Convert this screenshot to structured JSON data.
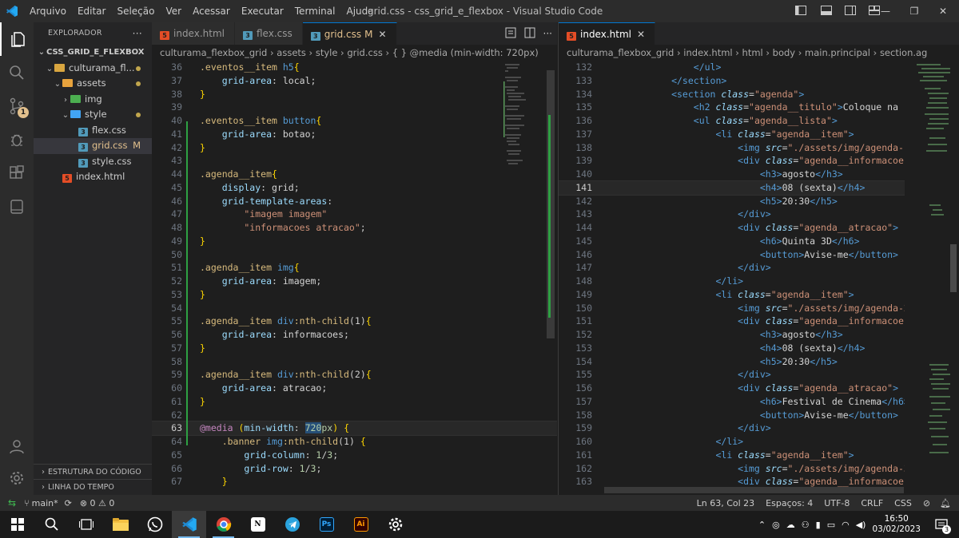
{
  "titlebar": {
    "menu": [
      "Arquivo",
      "Editar",
      "Seleção",
      "Ver",
      "Acessar",
      "Executar",
      "Terminal",
      "Ajuda"
    ],
    "title": "grid.css - css_grid_e_flexbox - Visual Studio Code"
  },
  "activity": {
    "source_control_badge": "1"
  },
  "sidebar": {
    "header": "EXPLORADOR",
    "root": "CSS_GRID_E_FLEXBOX",
    "tree": [
      {
        "label": "culturama_fl...",
        "type": "folder",
        "indent": 1,
        "open": true,
        "dot": true
      },
      {
        "label": "assets",
        "type": "folder",
        "indent": 2,
        "open": true,
        "dot": true
      },
      {
        "label": "img",
        "type": "folder",
        "indent": 3,
        "open": false,
        "dot": false
      },
      {
        "label": "style",
        "type": "folder",
        "indent": 3,
        "open": true,
        "dot": true
      },
      {
        "label": "flex.css",
        "type": "css",
        "indent": 4
      },
      {
        "label": "grid.css",
        "type": "css",
        "indent": 4,
        "selected": true,
        "badge": "M"
      },
      {
        "label": "style.css",
        "type": "css",
        "indent": 4
      },
      {
        "label": "index.html",
        "type": "html",
        "indent": 2
      }
    ],
    "footer": [
      "ESTRUTURA DO CÓDIGO",
      "LINHA DO TEMPO"
    ]
  },
  "left_editor": {
    "tabs": [
      {
        "label": "index.html",
        "type": "html"
      },
      {
        "label": "flex.css",
        "type": "css"
      },
      {
        "label": "grid.css",
        "type": "css",
        "active": true,
        "modified": "M"
      }
    ],
    "breadcrumb": [
      "culturama_flexbox_grid",
      "assets",
      "style",
      "grid.css",
      "{ } @media (min-width: 720px)"
    ],
    "lines": [
      {
        "n": 36,
        "t": [
          [
            "sel-s",
            ".eventos__item "
          ],
          [
            "tag",
            "h5"
          ],
          [
            "br1",
            "{"
          ]
        ]
      },
      {
        "n": 37,
        "t": [
          [
            "prop",
            "    grid-area"
          ],
          [
            "punc",
            ": "
          ],
          [
            "txt",
            "local"
          ],
          [
            "punc",
            ";"
          ]
        ]
      },
      {
        "n": 38,
        "t": [
          [
            "br1",
            "}"
          ]
        ]
      },
      {
        "n": 39,
        "t": []
      },
      {
        "n": 40,
        "t": [
          [
            "sel-s",
            ".eventos__item "
          ],
          [
            "tag",
            "button"
          ],
          [
            "br1",
            "{"
          ]
        ]
      },
      {
        "n": 41,
        "t": [
          [
            "prop",
            "    grid-area"
          ],
          [
            "punc",
            ": "
          ],
          [
            "txt",
            "botao"
          ],
          [
            "punc",
            ";"
          ]
        ]
      },
      {
        "n": 42,
        "t": [
          [
            "br1",
            "}"
          ]
        ]
      },
      {
        "n": 43,
        "t": []
      },
      {
        "n": 44,
        "t": [
          [
            "sel-s",
            ".agenda__item"
          ],
          [
            "br1",
            "{"
          ]
        ]
      },
      {
        "n": 45,
        "t": [
          [
            "prop",
            "    display"
          ],
          [
            "punc",
            ": "
          ],
          [
            "txt",
            "grid"
          ],
          [
            "punc",
            ";"
          ]
        ]
      },
      {
        "n": 46,
        "t": [
          [
            "prop",
            "    grid-template-areas"
          ],
          [
            "punc",
            ":"
          ]
        ]
      },
      {
        "n": 47,
        "t": [
          [
            "val",
            "        \"imagem imagem\""
          ]
        ]
      },
      {
        "n": 48,
        "t": [
          [
            "val",
            "        \"informacoes atracao\""
          ],
          [
            "punc",
            ";"
          ]
        ]
      },
      {
        "n": 49,
        "t": [
          [
            "br1",
            "}"
          ]
        ]
      },
      {
        "n": 50,
        "t": []
      },
      {
        "n": 51,
        "t": [
          [
            "sel-s",
            ".agenda__item "
          ],
          [
            "tag",
            "img"
          ],
          [
            "br1",
            "{"
          ]
        ]
      },
      {
        "n": 52,
        "t": [
          [
            "prop",
            "    grid-area"
          ],
          [
            "punc",
            ": "
          ],
          [
            "txt",
            "imagem"
          ],
          [
            "punc",
            ";"
          ]
        ]
      },
      {
        "n": 53,
        "t": [
          [
            "br1",
            "}"
          ]
        ]
      },
      {
        "n": 54,
        "t": []
      },
      {
        "n": 55,
        "t": [
          [
            "sel-s",
            ".agenda__item "
          ],
          [
            "tag",
            "div"
          ],
          [
            "sel-s",
            ":nth-child"
          ],
          [
            "punc",
            "(1)"
          ],
          [
            "br1",
            "{"
          ]
        ]
      },
      {
        "n": 56,
        "t": [
          [
            "prop",
            "    grid-area"
          ],
          [
            "punc",
            ": "
          ],
          [
            "txt",
            "informacoes"
          ],
          [
            "punc",
            ";"
          ]
        ]
      },
      {
        "n": 57,
        "t": [
          [
            "br1",
            "}"
          ]
        ]
      },
      {
        "n": 58,
        "t": []
      },
      {
        "n": 59,
        "t": [
          [
            "sel-s",
            ".agenda__item "
          ],
          [
            "tag",
            "div"
          ],
          [
            "sel-s",
            ":nth-child"
          ],
          [
            "punc",
            "(2)"
          ],
          [
            "br1",
            "{"
          ]
        ]
      },
      {
        "n": 60,
        "t": [
          [
            "prop",
            "    grid-area"
          ],
          [
            "punc",
            ": "
          ],
          [
            "txt",
            "atracao"
          ],
          [
            "punc",
            ";"
          ]
        ]
      },
      {
        "n": 61,
        "t": [
          [
            "br1",
            "}"
          ]
        ]
      },
      {
        "n": 62,
        "t": []
      },
      {
        "n": 63,
        "cur": true,
        "t": [
          [
            "kw",
            "@media"
          ],
          [
            "punc",
            " "
          ],
          [
            "br1",
            "("
          ],
          [
            "prop",
            "min-width"
          ],
          [
            "punc",
            ": "
          ],
          [
            "num",
            "720"
          ],
          [
            "num",
            "px"
          ],
          [
            "br1",
            ")"
          ],
          [
            "punc",
            " "
          ],
          [
            "br1",
            "{"
          ]
        ]
      },
      {
        "n": 64,
        "t": [
          [
            "sel-s",
            "    .banner "
          ],
          [
            "tag",
            "img"
          ],
          [
            "sel-s",
            ":nth-child"
          ],
          [
            "punc",
            "(1) "
          ],
          [
            "br1",
            "{"
          ]
        ]
      },
      {
        "n": 65,
        "t": [
          [
            "prop",
            "        grid-column"
          ],
          [
            "punc",
            ": "
          ],
          [
            "num",
            "1"
          ],
          [
            "punc",
            "/"
          ],
          [
            "num",
            "3"
          ],
          [
            "punc",
            ";"
          ]
        ]
      },
      {
        "n": 66,
        "t": [
          [
            "prop",
            "        grid-row"
          ],
          [
            "punc",
            ": "
          ],
          [
            "num",
            "1"
          ],
          [
            "punc",
            "/"
          ],
          [
            "num",
            "3"
          ],
          [
            "punc",
            ";"
          ]
        ]
      },
      {
        "n": 67,
        "t": [
          [
            "br1",
            "    }"
          ]
        ]
      }
    ]
  },
  "right_editor": {
    "tabs": [
      {
        "label": "index.html",
        "type": "html",
        "active": true
      }
    ],
    "breadcrumb": [
      "culturama_flexbox_grid",
      "index.html",
      "html",
      "body",
      "main.principal",
      "section.ag"
    ],
    "lines": [
      {
        "n": 132,
        "t": [
          [
            "tag",
            "                </ul>"
          ]
        ]
      },
      {
        "n": 133,
        "t": [
          [
            "tag",
            "            </section>"
          ]
        ]
      },
      {
        "n": 134,
        "t": [
          [
            "tag",
            "            <section "
          ],
          [
            "attr",
            "class"
          ],
          [
            "punc",
            "="
          ],
          [
            "aval",
            "\"agenda\""
          ],
          [
            "tag",
            ">"
          ]
        ]
      },
      {
        "n": 135,
        "t": [
          [
            "tag",
            "                <h2 "
          ],
          [
            "attr",
            "class"
          ],
          [
            "punc",
            "="
          ],
          [
            "aval",
            "\"agenda__titulo\""
          ],
          [
            "tag",
            ">"
          ],
          [
            "txt",
            "Coloque na sua ag"
          ]
        ]
      },
      {
        "n": 136,
        "t": [
          [
            "tag",
            "                <ul "
          ],
          [
            "attr",
            "class"
          ],
          [
            "punc",
            "="
          ],
          [
            "aval",
            "\"agenda__lista\""
          ],
          [
            "tag",
            ">"
          ]
        ]
      },
      {
        "n": 137,
        "t": [
          [
            "tag",
            "                    <li "
          ],
          [
            "attr",
            "class"
          ],
          [
            "punc",
            "="
          ],
          [
            "aval",
            "\"agenda__item\""
          ],
          [
            "tag",
            ">"
          ]
        ]
      },
      {
        "n": 138,
        "t": [
          [
            "tag",
            "                        <img "
          ],
          [
            "attr",
            "src"
          ],
          [
            "punc",
            "="
          ],
          [
            "aval",
            "\"./assets/img/agenda-1.png\""
          ]
        ]
      },
      {
        "n": 139,
        "t": [
          [
            "tag",
            "                        <div "
          ],
          [
            "attr",
            "class"
          ],
          [
            "punc",
            "="
          ],
          [
            "aval",
            "\"agenda__informacoes\""
          ],
          [
            "tag",
            ">"
          ]
        ]
      },
      {
        "n": 140,
        "t": [
          [
            "tag",
            "                            <h3>"
          ],
          [
            "txt",
            "agosto"
          ],
          [
            "tag",
            "</h3>"
          ]
        ]
      },
      {
        "n": 141,
        "cur": true,
        "t": [
          [
            "tag",
            "                            <h4>"
          ],
          [
            "txt",
            "08 (sexta)"
          ],
          [
            "tag",
            "</h4>"
          ]
        ]
      },
      {
        "n": 142,
        "t": [
          [
            "tag",
            "                            <h5>"
          ],
          [
            "txt",
            "20:30"
          ],
          [
            "tag",
            "</h5>"
          ]
        ]
      },
      {
        "n": 143,
        "t": [
          [
            "tag",
            "                        </div>"
          ]
        ]
      },
      {
        "n": 144,
        "t": [
          [
            "tag",
            "                        <div "
          ],
          [
            "attr",
            "class"
          ],
          [
            "punc",
            "="
          ],
          [
            "aval",
            "\"agenda__atracao\""
          ],
          [
            "tag",
            ">"
          ]
        ]
      },
      {
        "n": 145,
        "t": [
          [
            "tag",
            "                            <h6>"
          ],
          [
            "txt",
            "Quinta 3D"
          ],
          [
            "tag",
            "</h6>"
          ]
        ]
      },
      {
        "n": 146,
        "t": [
          [
            "tag",
            "                            <button>"
          ],
          [
            "txt",
            "Avise-me"
          ],
          [
            "tag",
            "</button>"
          ]
        ]
      },
      {
        "n": 147,
        "t": [
          [
            "tag",
            "                        </div>"
          ]
        ]
      },
      {
        "n": 148,
        "t": [
          [
            "tag",
            "                    </li>"
          ]
        ]
      },
      {
        "n": 149,
        "t": [
          [
            "tag",
            "                    <li "
          ],
          [
            "attr",
            "class"
          ],
          [
            "punc",
            "="
          ],
          [
            "aval",
            "\"agenda__item\""
          ],
          [
            "tag",
            ">"
          ]
        ]
      },
      {
        "n": 150,
        "t": [
          [
            "tag",
            "                        <img "
          ],
          [
            "attr",
            "src"
          ],
          [
            "punc",
            "="
          ],
          [
            "aval",
            "\"./assets/img/agenda-2.png\""
          ]
        ]
      },
      {
        "n": 151,
        "t": [
          [
            "tag",
            "                        <div "
          ],
          [
            "attr",
            "class"
          ],
          [
            "punc",
            "="
          ],
          [
            "aval",
            "\"agenda__informacoes\""
          ],
          [
            "tag",
            ">"
          ]
        ]
      },
      {
        "n": 152,
        "t": [
          [
            "tag",
            "                            <h3>"
          ],
          [
            "txt",
            "agosto"
          ],
          [
            "tag",
            "</h3>"
          ]
        ]
      },
      {
        "n": 153,
        "t": [
          [
            "tag",
            "                            <h4>"
          ],
          [
            "txt",
            "08 (sexta)"
          ],
          [
            "tag",
            "</h4>"
          ]
        ]
      },
      {
        "n": 154,
        "t": [
          [
            "tag",
            "                            <h5>"
          ],
          [
            "txt",
            "20:30"
          ],
          [
            "tag",
            "</h5>"
          ]
        ]
      },
      {
        "n": 155,
        "t": [
          [
            "tag",
            "                        </div>"
          ]
        ]
      },
      {
        "n": 156,
        "t": [
          [
            "tag",
            "                        <div "
          ],
          [
            "attr",
            "class"
          ],
          [
            "punc",
            "="
          ],
          [
            "aval",
            "\"agenda__atracao\""
          ],
          [
            "tag",
            ">"
          ]
        ]
      },
      {
        "n": 157,
        "t": [
          [
            "tag",
            "                            <h6>"
          ],
          [
            "txt",
            "Festival de Cinema"
          ],
          [
            "tag",
            "</h6>"
          ]
        ]
      },
      {
        "n": 158,
        "t": [
          [
            "tag",
            "                            <button>"
          ],
          [
            "txt",
            "Avise-me"
          ],
          [
            "tag",
            "</button>"
          ]
        ]
      },
      {
        "n": 159,
        "t": [
          [
            "tag",
            "                        </div>"
          ]
        ]
      },
      {
        "n": 160,
        "t": [
          [
            "tag",
            "                    </li>"
          ]
        ]
      },
      {
        "n": 161,
        "t": [
          [
            "tag",
            "                    <li "
          ],
          [
            "attr",
            "class"
          ],
          [
            "punc",
            "="
          ],
          [
            "aval",
            "\"agenda__item\""
          ],
          [
            "tag",
            ">"
          ]
        ]
      },
      {
        "n": 162,
        "t": [
          [
            "tag",
            "                        <img "
          ],
          [
            "attr",
            "src"
          ],
          [
            "punc",
            "="
          ],
          [
            "aval",
            "\"./assets/img/agenda-3.png\""
          ]
        ]
      },
      {
        "n": 163,
        "t": [
          [
            "tag",
            "                        <div "
          ],
          [
            "attr",
            "class"
          ],
          [
            "punc",
            "="
          ],
          [
            "aval",
            "\"agenda__informacoes\""
          ],
          [
            "tag",
            ">"
          ]
        ]
      }
    ]
  },
  "statusbar": {
    "branch": "main*",
    "problems": "⊗ 0 ⚠ 0",
    "position": "Ln 63, Col 23",
    "spaces": "Espaços: 4",
    "encoding": "UTF-8",
    "eol": "CRLF",
    "language": "CSS"
  },
  "taskbar": {
    "time": "16:50",
    "date": "03/02/2023",
    "notifications": "3"
  },
  "colors": {
    "accent": "#007acc",
    "modified": "#e2c08d",
    "html_icon": "#e44d26",
    "css_icon": "#519aba"
  }
}
